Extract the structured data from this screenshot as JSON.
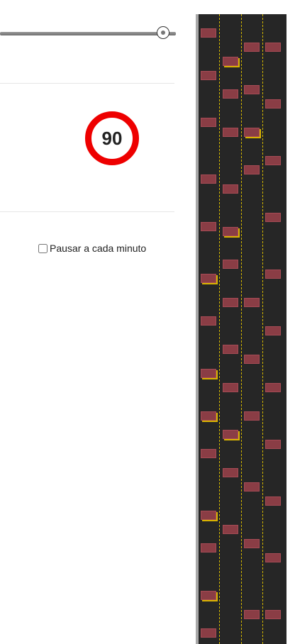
{
  "speed": {
    "value": "90",
    "ring_color": "#ee0000"
  },
  "pause": {
    "label": "Pausar a cada minuto",
    "checked": false
  },
  "slider": {
    "level": 0.94
  },
  "road": {
    "surface_color": "#262626",
    "lane_line_color": "#d4b800",
    "car_color": "#8a3d45"
  }
}
